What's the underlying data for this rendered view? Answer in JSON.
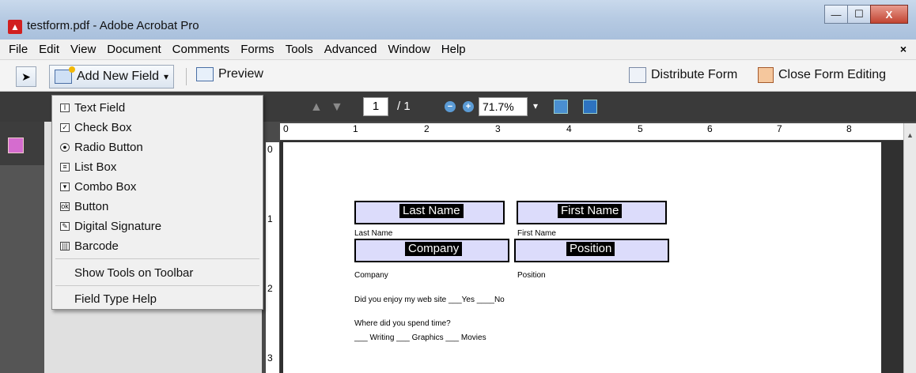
{
  "window": {
    "title": "testform.pdf - Adobe Acrobat Pro",
    "minimize": "—",
    "maximize": "☐",
    "close": "X"
  },
  "menu": [
    "File",
    "Edit",
    "View",
    "Document",
    "Comments",
    "Forms",
    "Tools",
    "Advanced",
    "Window",
    "Help"
  ],
  "menu_close": "×",
  "toolbar": {
    "add_field": "Add New Field",
    "add_field_caret": "▾",
    "preview": "Preview",
    "distribute": "Distribute Form",
    "close_editing": "Close Form Editing"
  },
  "nav": {
    "page": "1",
    "total": "/ 1",
    "zoom": "71.7%",
    "zoom_caret": "▾"
  },
  "ruler": {
    "h": [
      "0",
      "1",
      "2",
      "3",
      "4",
      "5",
      "6",
      "7",
      "8"
    ],
    "v": [
      "0",
      "1",
      "2",
      "3"
    ]
  },
  "dropdown": {
    "items": [
      "Text Field",
      "Check Box",
      "Radio Button",
      "List Box",
      "Combo Box",
      "Button",
      "Digital Signature",
      "Barcode"
    ],
    "show_tools": "Show Tools on Toolbar",
    "help": "Field Type Help"
  },
  "form": {
    "last_name_field": "Last Name",
    "first_name_field": "First Name",
    "last_name_label": "Last Name",
    "first_name_label": "First Name",
    "company_field": "Company",
    "position_field": "Position",
    "company_label": "Company",
    "position_label": "Position",
    "q1": "Did you enjoy my web site   ___Yes   ____No",
    "q2": "Where did you spend time?",
    "q2_opts": "___ Writing  ___ Graphics  ___ Movies"
  }
}
